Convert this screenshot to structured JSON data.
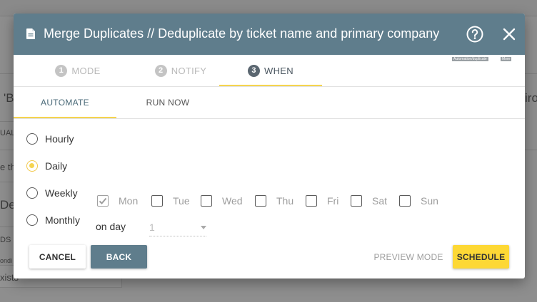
{
  "background": {
    "fragments": [
      "'B",
      "UAL",
      "e th",
      "De",
      "DS",
      "ondi",
      "xists",
      "iro"
    ]
  },
  "dialog": {
    "title": "Merge Duplicates // Deduplicate by ticket name and primary company",
    "help_icon": "help-circle-icon",
    "close_icon": "close-icon"
  },
  "steps": [
    {
      "number": "1",
      "label": "MODE",
      "active": false
    },
    {
      "number": "2",
      "label": "NOTIFY",
      "active": false
    },
    {
      "number": "3",
      "label": "WHEN",
      "active": true
    }
  ],
  "tiny_chips": [
    "Automation/duplicate",
    "More"
  ],
  "subtabs": [
    {
      "label": "AUTOMATE",
      "active": true
    },
    {
      "label": "RUN NOW",
      "active": false
    }
  ],
  "frequency": {
    "options": [
      "Hourly",
      "Daily",
      "Weekly",
      "Monthly"
    ],
    "selected": "Daily"
  },
  "weekdays": [
    {
      "label": "Mon",
      "checked": true
    },
    {
      "label": "Tue",
      "checked": false
    },
    {
      "label": "Wed",
      "checked": false
    },
    {
      "label": "Thu",
      "checked": false
    },
    {
      "label": "Fri",
      "checked": false
    },
    {
      "label": "Sat",
      "checked": false
    },
    {
      "label": "Sun",
      "checked": false
    }
  ],
  "on_day": {
    "label": "on day",
    "value": "1"
  },
  "buttons": {
    "cancel": "CANCEL",
    "back": "BACK",
    "preview": "PREVIEW MODE",
    "schedule": "SCHEDULE"
  },
  "colors": {
    "header": "#5f7d8c",
    "accent": "#f5d44f",
    "schedule": "#fdd835"
  }
}
